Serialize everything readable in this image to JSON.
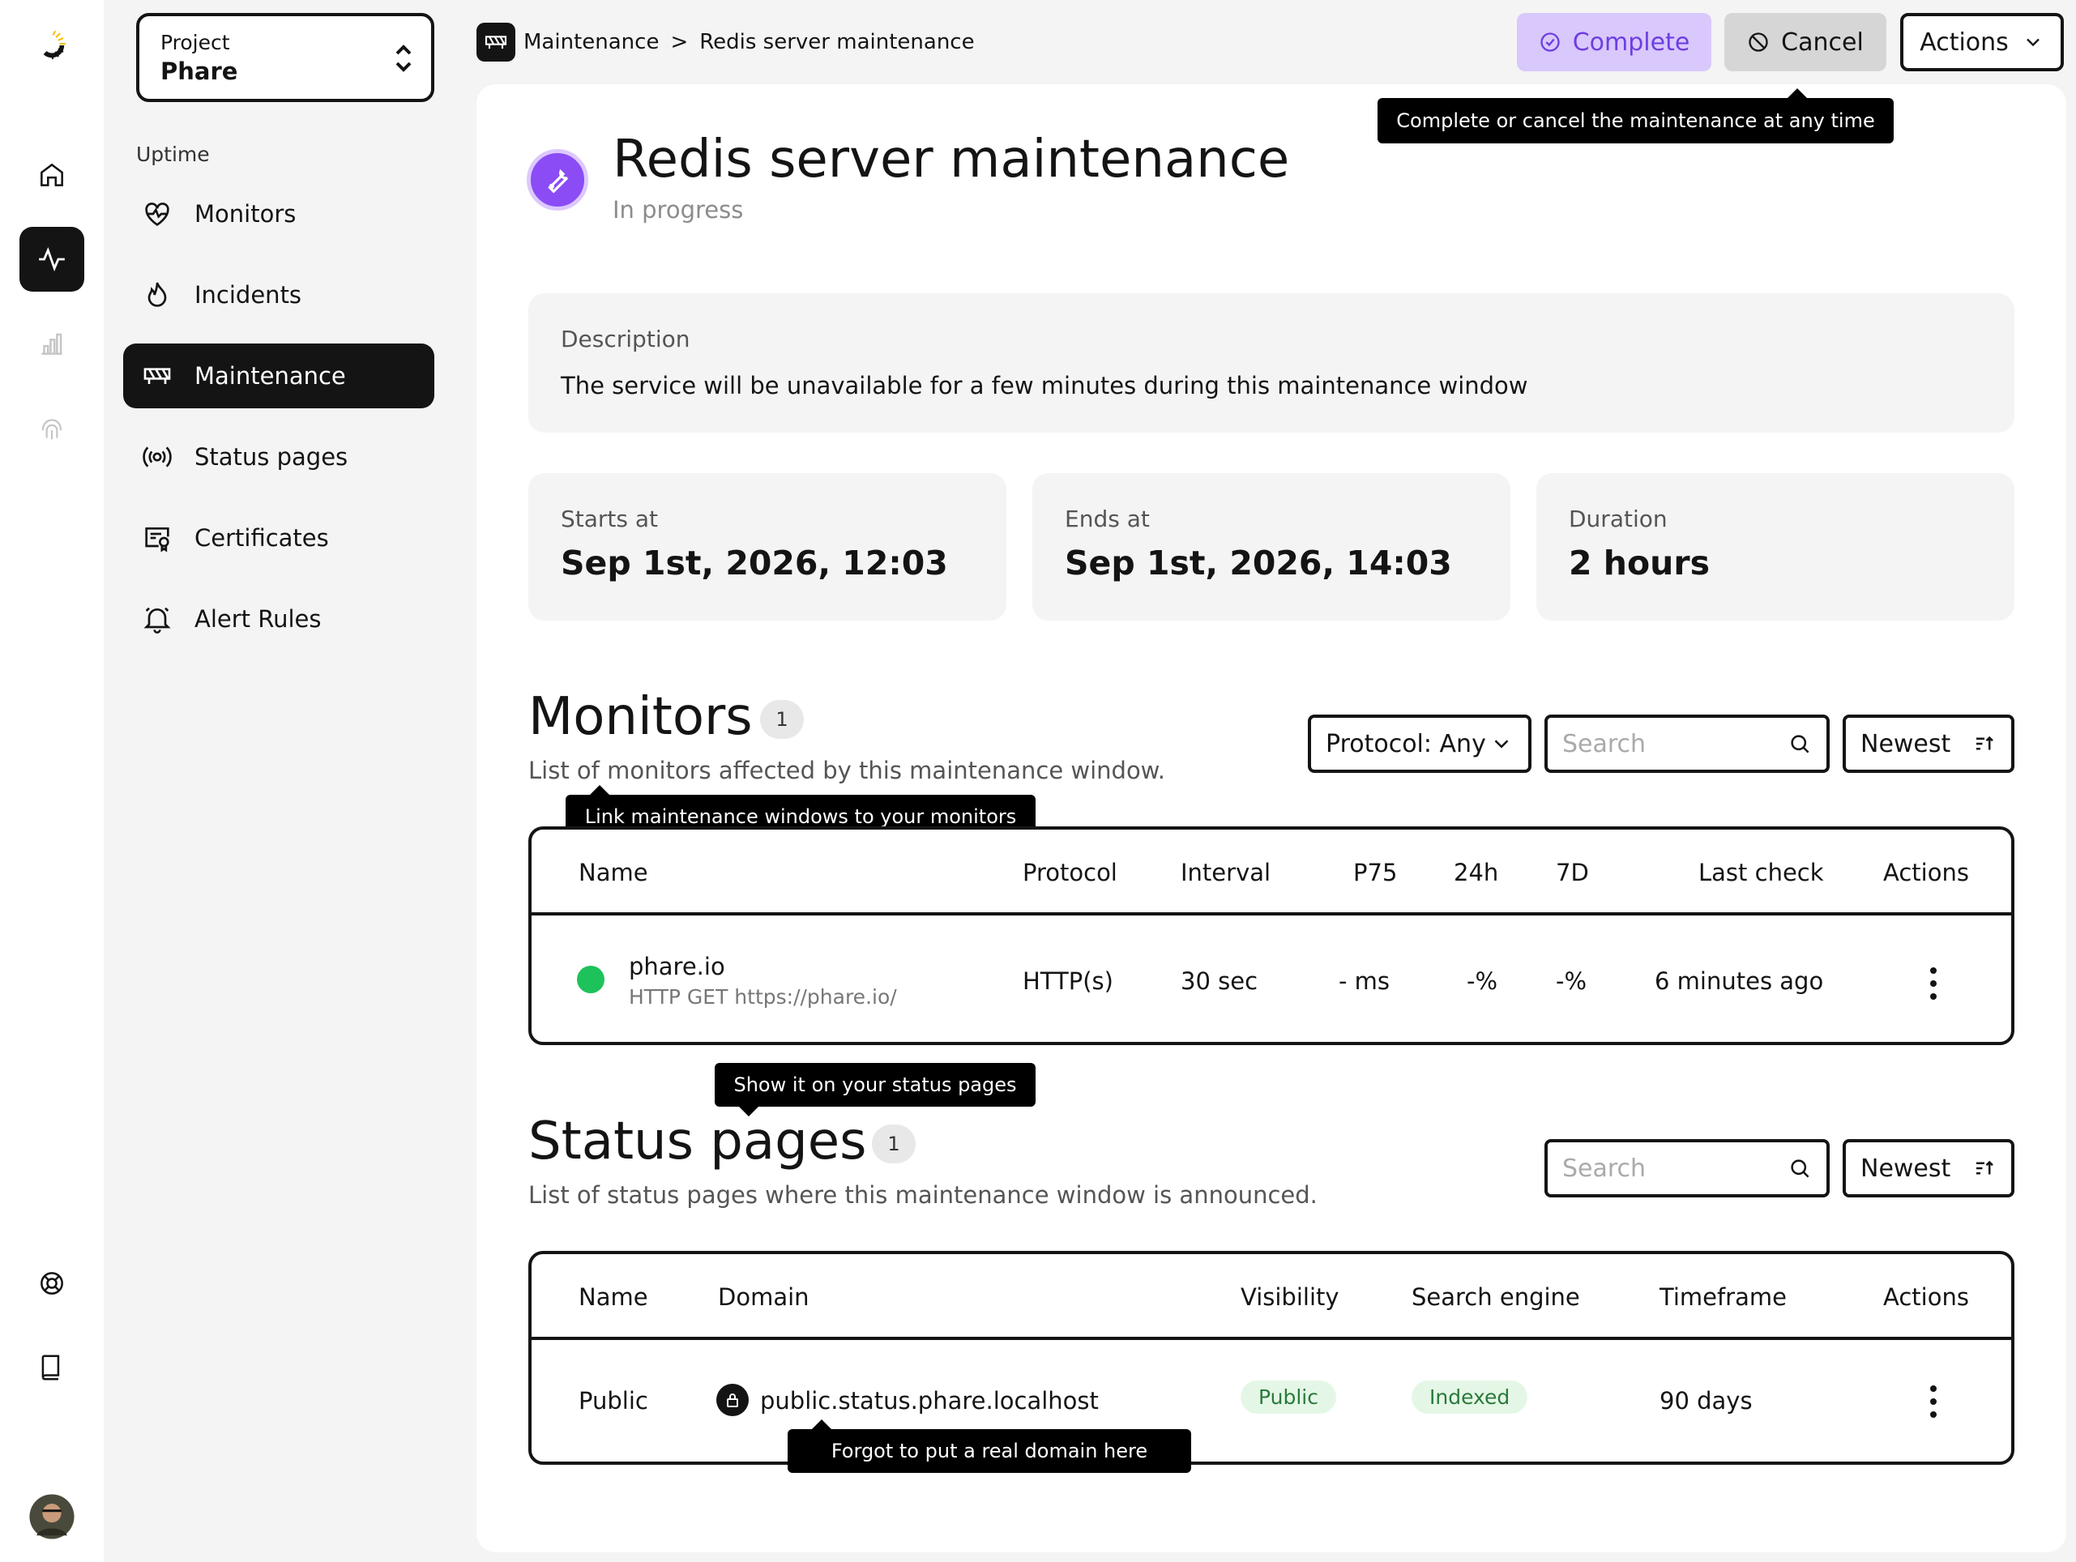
{
  "project": {
    "label": "Project",
    "name": "Phare"
  },
  "sidebar": {
    "section": "Uptime",
    "items": [
      {
        "label": "Monitors",
        "icon": "heart-pulse-icon"
      },
      {
        "label": "Incidents",
        "icon": "flame-icon"
      },
      {
        "label": "Maintenance",
        "icon": "maintenance-barrier-icon",
        "active": true
      },
      {
        "label": "Status pages",
        "icon": "broadcast-icon"
      },
      {
        "label": "Certificates",
        "icon": "certificate-icon"
      },
      {
        "label": "Alert Rules",
        "icon": "bell-icon"
      }
    ]
  },
  "breadcrumb": {
    "parent": "Maintenance",
    "separator": ">",
    "current": "Redis server maintenance"
  },
  "toolbar": {
    "complete": "Complete",
    "cancel": "Cancel",
    "actions": "Actions"
  },
  "tooltips": {
    "complete_cancel": "Complete or cancel the maintenance at any time",
    "link_monitors": "Link maintenance windows to your monitors",
    "status_pages": "Show it on your status pages",
    "domain": "Forgot to put a real domain here"
  },
  "maintenance": {
    "title": "Redis server maintenance",
    "status": "In progress",
    "description_label": "Description",
    "description": "The service will be unavailable for a few minutes during this maintenance window",
    "starts_label": "Starts at",
    "starts": "Sep 1st, 2026, 12:03",
    "ends_label": "Ends at",
    "ends": "Sep 1st, 2026, 14:03",
    "duration_label": "Duration",
    "duration": "2 hours"
  },
  "monitors": {
    "title": "Monitors",
    "count": "1",
    "subtitle": "List of monitors affected by this maintenance window.",
    "filter": "Protocol: Any",
    "search_placeholder": "Search",
    "sort": "Newest",
    "columns": [
      "Name",
      "Protocol",
      "Interval",
      "P75",
      "24h",
      "7D",
      "Last check",
      "Actions"
    ],
    "rows": [
      {
        "name": "phare.io",
        "detail": "HTTP GET https://phare.io/",
        "protocol": "HTTP(s)",
        "interval": "30 sec",
        "p75": "- ms",
        "h24": "-%",
        "d7": "-%",
        "last_check": "6 minutes ago",
        "status_color": "#1ec25a"
      }
    ]
  },
  "status_pages": {
    "title": "Status pages",
    "count": "1",
    "subtitle": "List of status pages where this maintenance window is announced.",
    "search_placeholder": "Search",
    "sort": "Newest",
    "columns": [
      "Name",
      "Domain",
      "Visibility",
      "Search engine",
      "Timeframe",
      "Actions"
    ],
    "rows": [
      {
        "name": "Public",
        "domain": "public.status.phare.localhost",
        "visibility": "Public",
        "search_engine": "Indexed",
        "timeframe": "90 days"
      }
    ]
  },
  "colors": {
    "accent": "#8b4cf5",
    "complete_bg": "#d9c8fb",
    "complete_fg": "#6d3fe0",
    "up": "#1ec25a"
  }
}
